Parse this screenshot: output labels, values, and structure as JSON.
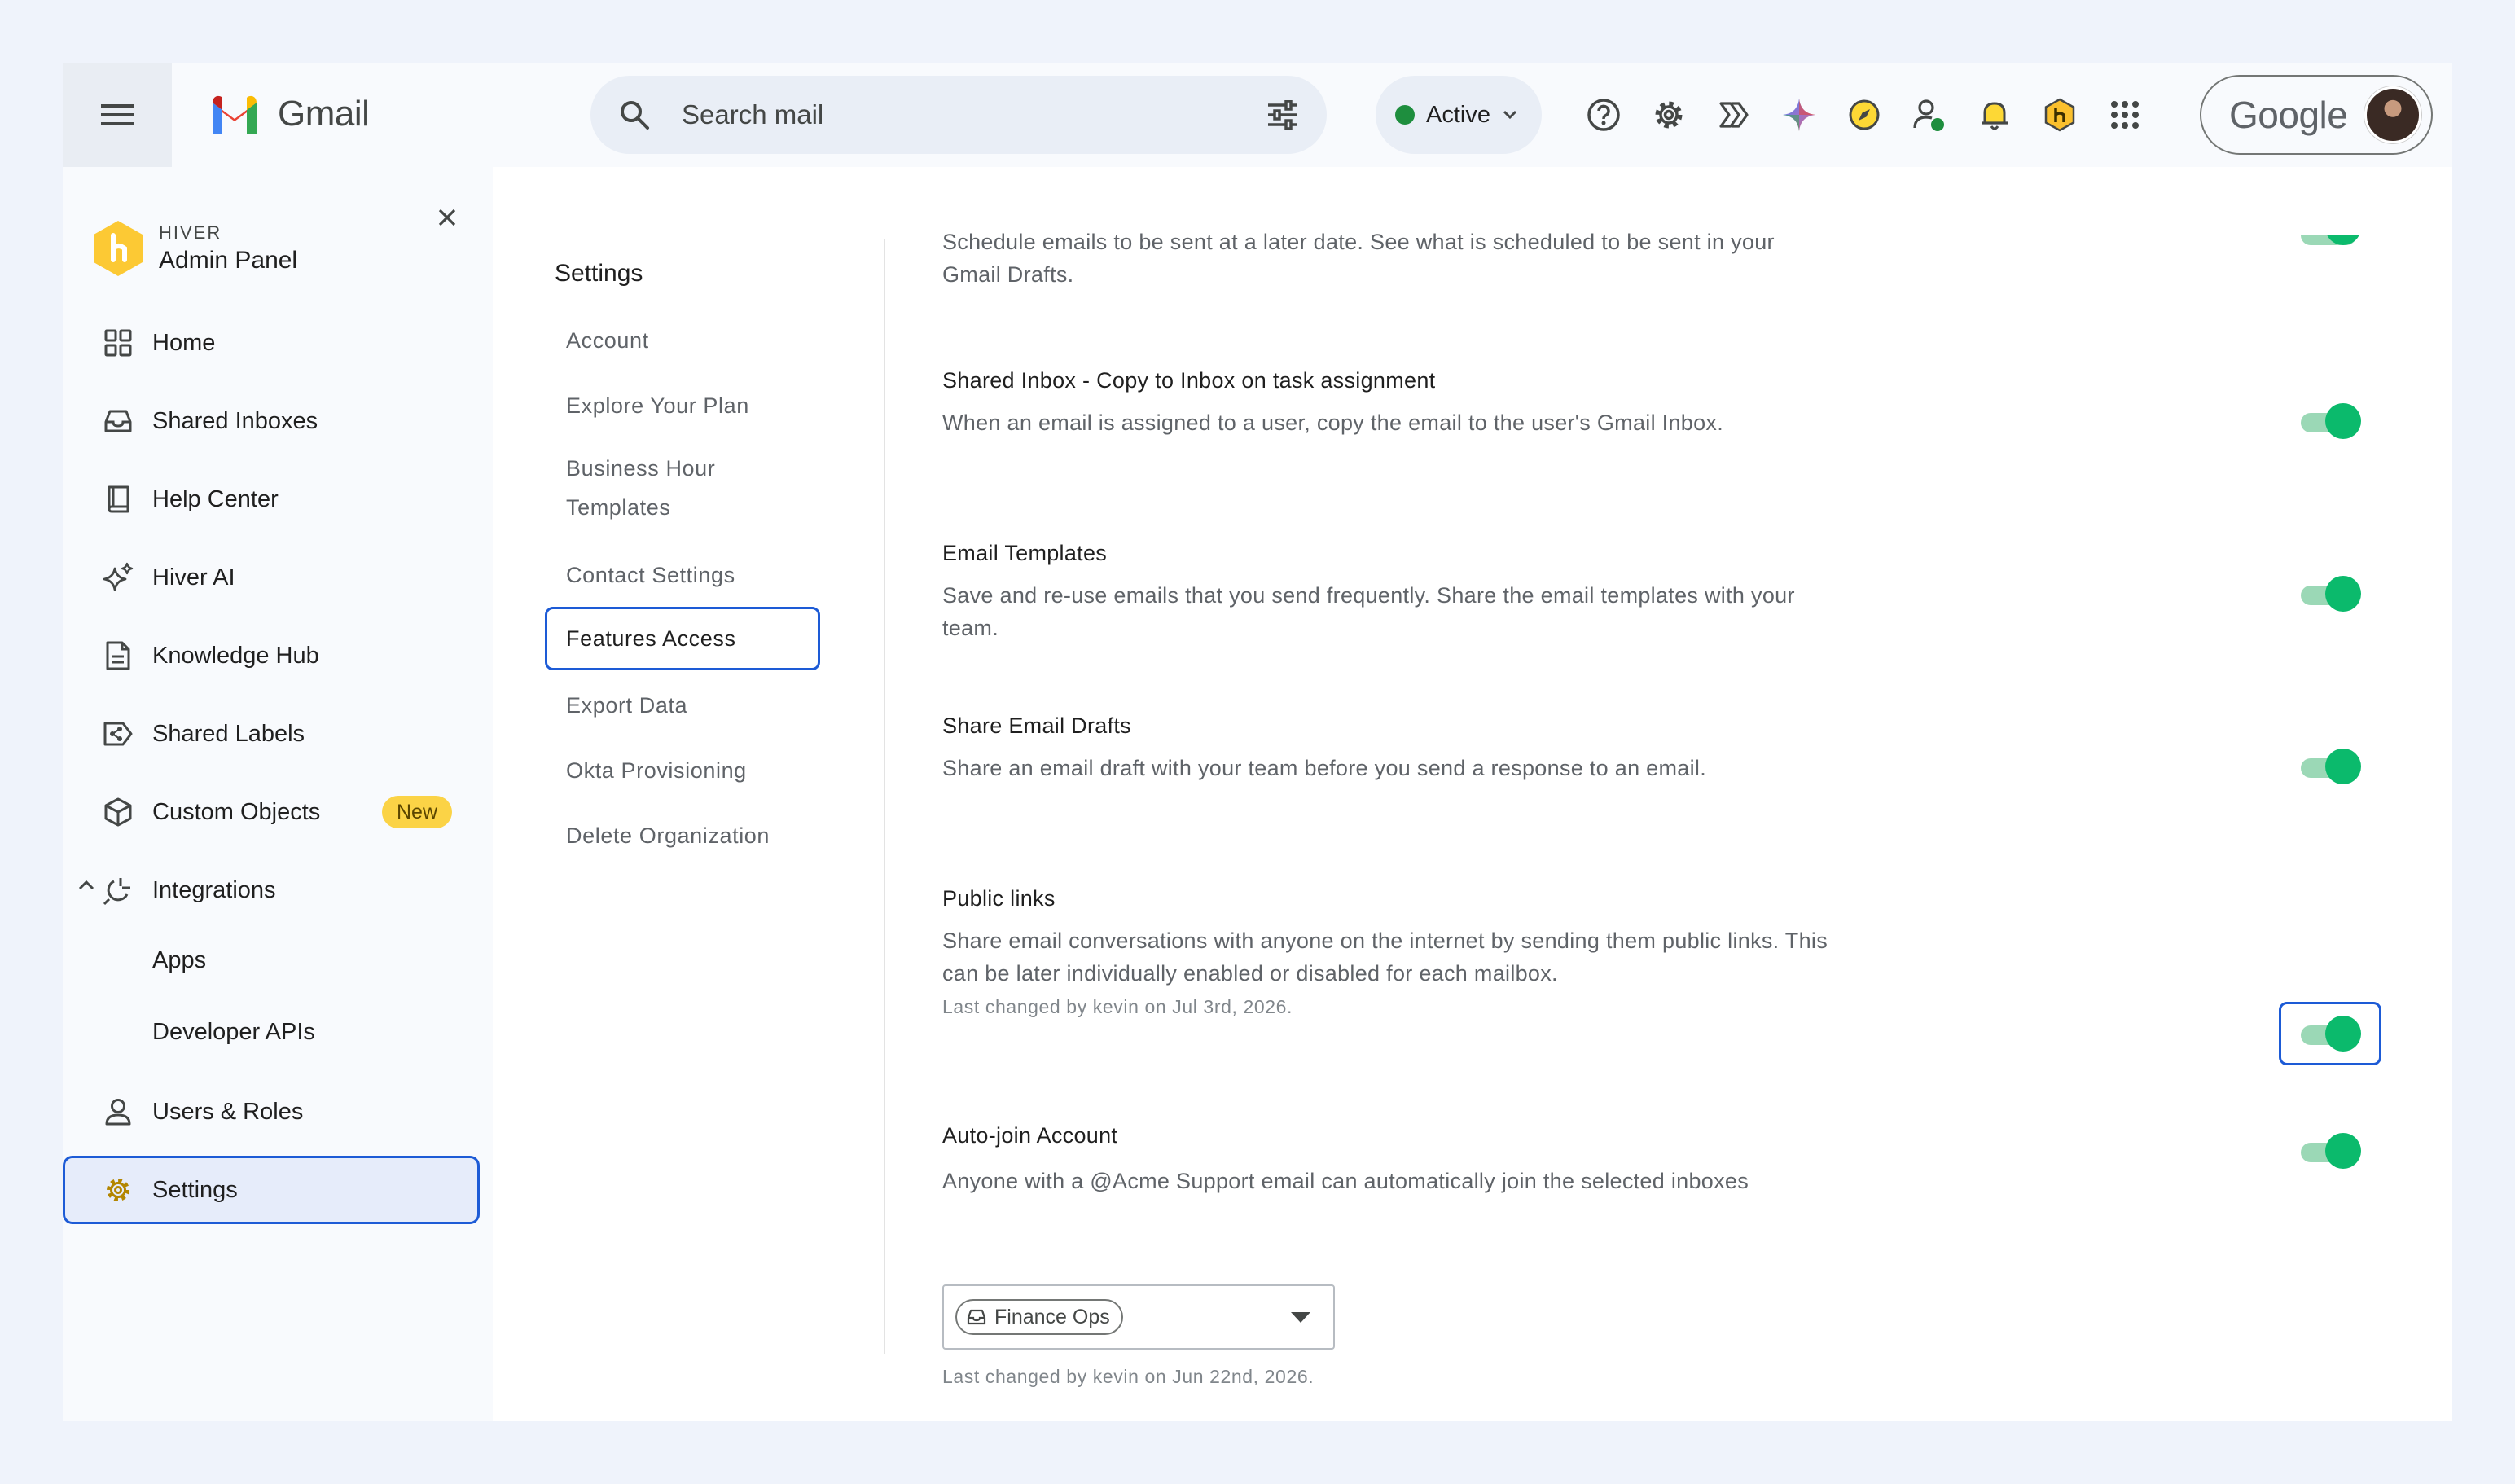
{
  "app": {
    "name": "Gmail"
  },
  "search": {
    "placeholder": "Search mail"
  },
  "status": {
    "label": "Active"
  },
  "account": {
    "label": "Google"
  },
  "admin_panel": {
    "brand": "HIVER",
    "title": "Admin Panel",
    "nav": [
      {
        "label": "Home"
      },
      {
        "label": "Shared Inboxes"
      },
      {
        "label": "Help Center"
      },
      {
        "label": "Hiver AI"
      },
      {
        "label": "Knowledge Hub"
      },
      {
        "label": "Shared Labels"
      },
      {
        "label": "Custom Objects",
        "badge": "New"
      },
      {
        "label": "Integrations"
      },
      {
        "label": "Apps"
      },
      {
        "label": "Developer APIs"
      },
      {
        "label": "Users & Roles"
      },
      {
        "label": "Settings"
      }
    ]
  },
  "settings": {
    "title": "Settings",
    "nav": [
      {
        "label": "Account"
      },
      {
        "label": "Explore Your Plan"
      },
      {
        "label": "Business Hour Templates"
      },
      {
        "label": "Contact Settings"
      },
      {
        "label": "Features Access"
      },
      {
        "label": "Export Data"
      },
      {
        "label": "Okta Provisioning"
      },
      {
        "label": "Delete Organization"
      }
    ]
  },
  "features": [
    {
      "title": "",
      "desc": "Schedule emails to be sent at a later date. See what is scheduled to be sent in your Gmail Drafts.",
      "enabled": true
    },
    {
      "title": "Shared Inbox - Copy to Inbox on task assignment",
      "desc": "When an email is assigned to a user, copy the email to the user's Gmail Inbox.",
      "enabled": true
    },
    {
      "title": "Email Templates",
      "desc": "Save and re-use emails that you send frequently. Share the email templates with your team.",
      "enabled": true
    },
    {
      "title": "Share Email Drafts",
      "desc": "Share an email draft with your team before you send a response to an email.",
      "enabled": true
    },
    {
      "title": "Public links",
      "desc": "Share email conversations with anyone on the internet by sending them public links. This can be later individually enabled or disabled for each mailbox.",
      "meta": "Last changed by kevin on Jul 3rd, 2026.",
      "enabled": true
    },
    {
      "title": "Auto-join Account",
      "desc": "Anyone with a @Acme Support email can automatically join the selected inboxes",
      "meta": "Last changed by kevin on Jun 22nd, 2026.",
      "enabled": true,
      "selected_inbox": "Finance Ops"
    }
  ],
  "colors": {
    "accent": "#1d5bd6",
    "toggle_on": "#0bba6c",
    "badge": "#fbd346"
  }
}
